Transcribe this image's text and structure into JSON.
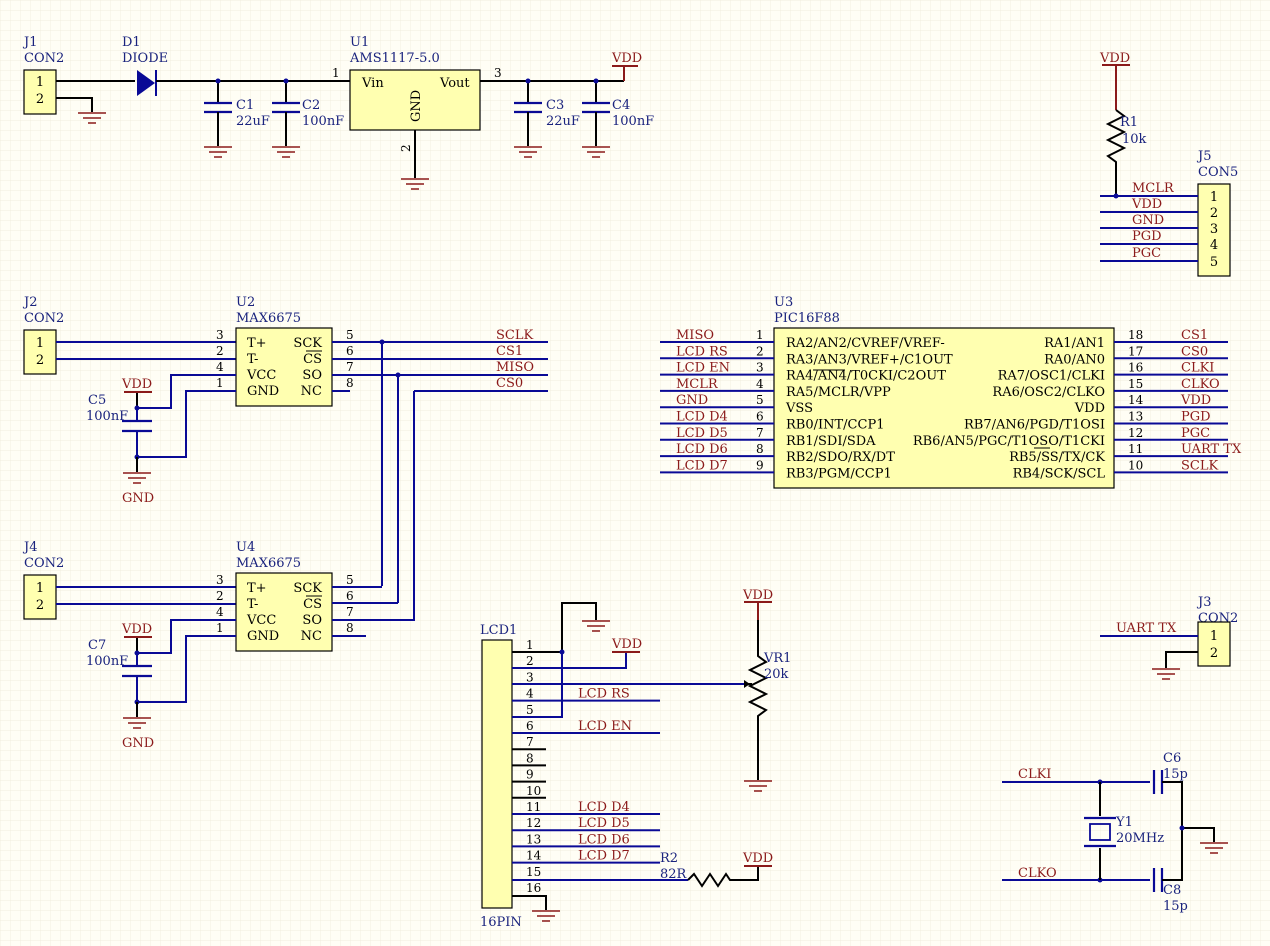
{
  "j1": {
    "ref": "J1",
    "value": "CON2",
    "pins": [
      "1",
      "2"
    ]
  },
  "d1": {
    "ref": "D1",
    "value": "DIODE"
  },
  "u1": {
    "ref": "U1",
    "value": "AMS1117-5.0",
    "vin": "Vin",
    "vout": "Vout",
    "gnd": "GND",
    "pin_in": "1",
    "pin_out": "3",
    "pin_gnd": "2"
  },
  "c1": {
    "ref": "C1",
    "value": "22uF"
  },
  "c2": {
    "ref": "C2",
    "value": "100nF"
  },
  "c3": {
    "ref": "C3",
    "value": "22uF"
  },
  "c4": {
    "ref": "C4",
    "value": "100nF"
  },
  "vdd": "VDD",
  "gnd": "GND",
  "r1": {
    "ref": "R1",
    "value": "10k"
  },
  "j5": {
    "ref": "J5",
    "value": "CON5",
    "pins": [
      "1",
      "2",
      "3",
      "4",
      "5"
    ],
    "nets": [
      "MCLR",
      "VDD",
      "GND",
      "PGD",
      "PGC"
    ]
  },
  "j2": {
    "ref": "J2",
    "value": "CON2",
    "pins": [
      "1",
      "2"
    ]
  },
  "j4": {
    "ref": "J4",
    "value": "CON2",
    "pins": [
      "1",
      "2"
    ]
  },
  "u2": {
    "ref": "U2",
    "value": "MAX6675"
  },
  "u4": {
    "ref": "U4",
    "value": "MAX6675"
  },
  "max_pins_left": [
    {
      "num": "3",
      "name": "T+"
    },
    {
      "num": "2",
      "name": "T-"
    },
    {
      "num": "4",
      "name": "VCC"
    },
    {
      "num": "1",
      "name": "GND"
    }
  ],
  "max_pins_right": [
    {
      "num": "5",
      "name": "SCK"
    },
    {
      "num": "6",
      "name": "CS"
    },
    {
      "num": "7",
      "name": "SO"
    },
    {
      "num": "8",
      "name": "NC"
    }
  ],
  "u2_nets": [
    "SCLK",
    "CS1",
    "MISO",
    "CS0"
  ],
  "c5": {
    "ref": "C5",
    "value": "100nF"
  },
  "c7": {
    "ref": "C7",
    "value": "100nF"
  },
  "u3": {
    "ref": "U3",
    "value": "PIC16F88",
    "left": [
      {
        "net": "MISO",
        "num": "1",
        "name": "RA2/AN2/CVREF/VREF-"
      },
      {
        "net": "LCD_RS",
        "num": "2",
        "name": "RA3/AN3/VREF+/C1OUT"
      },
      {
        "net": "LCD_EN",
        "num": "3",
        "name": "RA4/AN4/T0CKI/C2OUT"
      },
      {
        "net": "MCLR",
        "num": "4",
        "name": "RA5/MCLR/VPP"
      },
      {
        "net": "GND",
        "num": "5",
        "name": "VSS"
      },
      {
        "net": "LCD_D4",
        "num": "6",
        "name": "RB0/INT/CCP1"
      },
      {
        "net": "LCD_D5",
        "num": "7",
        "name": "RB1/SDI/SDA"
      },
      {
        "net": "LCD_D6",
        "num": "8",
        "name": "RB2/SDO/RX/DT"
      },
      {
        "net": "LCD_D7",
        "num": "9",
        "name": "RB3/PGM/CCP1"
      }
    ],
    "right": [
      {
        "net": "CS1",
        "num": "18",
        "name": "RA1/AN1"
      },
      {
        "net": "CS0",
        "num": "17",
        "name": "RA0/AN0"
      },
      {
        "net": "CLKI",
        "num": "16",
        "name": "RA7/OSC1/CLKI"
      },
      {
        "net": "CLKO",
        "num": "15",
        "name": "RA6/OSC2/CLKO"
      },
      {
        "net": "VDD",
        "num": "14",
        "name": "VDD"
      },
      {
        "net": "PGD",
        "num": "13",
        "name": "RB7/AN6/PGD/T1OSI"
      },
      {
        "net": "PGC",
        "num": "12",
        "name": "RB6/AN5/PGC/T1OSO/T1CKI"
      },
      {
        "net": "UART_TX",
        "num": "11",
        "name": "RB5/SS/TX/CK"
      },
      {
        "net": "SCLK",
        "num": "10",
        "name": "RB4/SCK/SCL"
      }
    ]
  },
  "lcd1": {
    "ref": "LCD1",
    "value": "16PIN",
    "pins": [
      "1",
      "2",
      "3",
      "4",
      "5",
      "6",
      "7",
      "8",
      "9",
      "10",
      "11",
      "12",
      "13",
      "14",
      "15",
      "16"
    ],
    "nets": {
      "4": "LCD_RS",
      "6": "LCD_EN",
      "11": "LCD_D4",
      "12": "LCD_D5",
      "13": "LCD_D6",
      "14": "LCD_D7"
    }
  },
  "vr1": {
    "ref": "VR1",
    "value": "20k"
  },
  "r2": {
    "ref": "R2",
    "value": "82R"
  },
  "j3": {
    "ref": "J3",
    "value": "CON2",
    "pins": [
      "1",
      "2"
    ],
    "net": "UART_TX"
  },
  "y1": {
    "ref": "Y1",
    "value": "20MHz"
  },
  "c6": {
    "ref": "C6",
    "value": "15p"
  },
  "c8": {
    "ref": "C8",
    "value": "15p"
  },
  "xtal_nets": [
    "CLKI",
    "CLKO"
  ]
}
